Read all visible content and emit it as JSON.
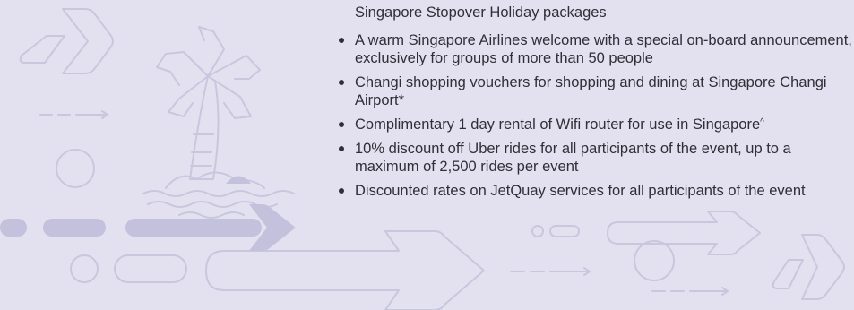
{
  "intro_text": "Singapore Stopover Holiday packages",
  "benefits": [
    {
      "text": "A warm Singapore Airlines welcome with a special on-board announcement, exclusively for groups of more than 50 people"
    },
    {
      "text": "Changi shopping vouchers for shopping and dining at Singapore Changi Airport*"
    },
    {
      "text": "Complimentary 1 day rental of Wifi router for use in Singapore",
      "sup": "^"
    },
    {
      "text": "10% discount off Uber rides for all participants of the event, up to a maximum of 2,500 rides per event"
    },
    {
      "text": "Discounted rates on JetQuay services for all participants of the event"
    }
  ],
  "decoration": {
    "palm_tree": "palm-tree-icon",
    "arrow": "arrow-icon",
    "circle": "circle-icon",
    "pill": "pill-icon"
  },
  "colors": {
    "background": "#e3e1ef",
    "decoration_line": "#c9c7de",
    "decoration_fill": "#c3c1dc",
    "text": "#2f2f37"
  }
}
